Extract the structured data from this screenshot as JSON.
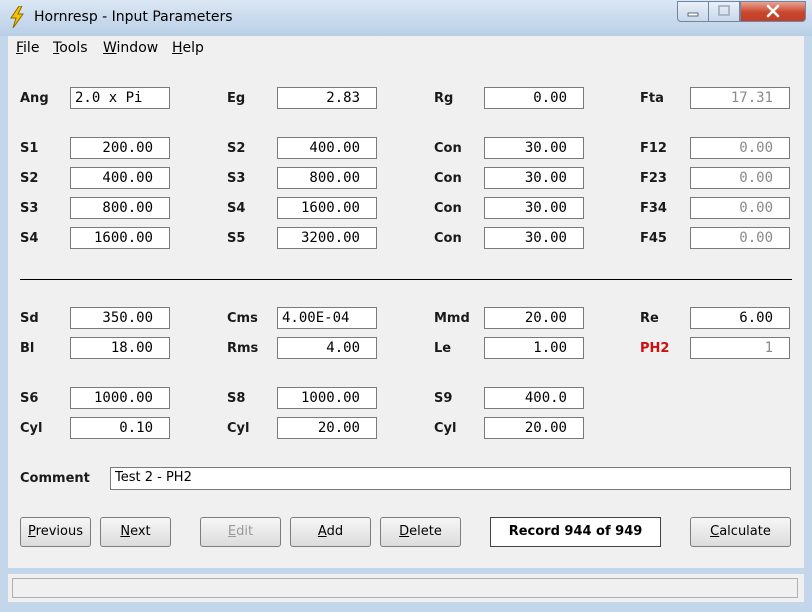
{
  "window": {
    "title": "Hornresp - Input Parameters"
  },
  "menu": [
    {
      "key": "F",
      "rest": "ile"
    },
    {
      "key": "T",
      "rest": "ools"
    },
    {
      "key": "W",
      "rest": "indow"
    },
    {
      "key": "H",
      "rest": "elp"
    }
  ],
  "params": {
    "ang": {
      "label": "Ang",
      "value": "2.0 x Pi"
    },
    "eg": {
      "label": "Eg",
      "value": "2.83"
    },
    "rg": {
      "label": "Rg",
      "value": "0.00"
    },
    "fta": {
      "label": "Fta",
      "value": "17.31"
    },
    "horn_rows": [
      {
        "sa": "S1",
        "sa_val": "200.00",
        "sb": "S2",
        "sb_val": "400.00",
        "con": "Con",
        "con_val": "30.00",
        "f": "F12",
        "f_val": "0.00"
      },
      {
        "sa": "S2",
        "sa_val": "400.00",
        "sb": "S3",
        "sb_val": "800.00",
        "con": "Con",
        "con_val": "30.00",
        "f": "F23",
        "f_val": "0.00"
      },
      {
        "sa": "S3",
        "sa_val": "800.00",
        "sb": "S4",
        "sb_val": "1600.00",
        "con": "Con",
        "con_val": "30.00",
        "f": "F34",
        "f_val": "0.00"
      },
      {
        "sa": "S4",
        "sa_val": "1600.00",
        "sb": "S5",
        "sb_val": "3200.00",
        "con": "Con",
        "con_val": "30.00",
        "f": "F45",
        "f_val": "0.00"
      }
    ],
    "sd": {
      "label": "Sd",
      "value": "350.00"
    },
    "cms": {
      "label": "Cms",
      "value": "4.00E-04"
    },
    "mmd": {
      "label": "Mmd",
      "value": "20.00"
    },
    "re": {
      "label": "Re",
      "value": "6.00"
    },
    "bl": {
      "label": "Bl",
      "value": "18.00"
    },
    "rms": {
      "label": "Rms",
      "value": "4.00"
    },
    "le": {
      "label": "Le",
      "value": "1.00"
    },
    "ph2": {
      "label": "PH2",
      "value": "1"
    },
    "s6": {
      "label": "S6",
      "value": "1000.00"
    },
    "s8": {
      "label": "S8",
      "value": "1000.00"
    },
    "s9": {
      "label": "S9",
      "value": "400.0"
    },
    "cyl1": {
      "label": "Cyl",
      "value": "0.10"
    },
    "cyl2": {
      "label": "Cyl",
      "value": "20.00"
    },
    "cyl3": {
      "label": "Cyl",
      "value": "20.00"
    }
  },
  "comment": {
    "label": "Comment",
    "value": "Test 2 - PH2"
  },
  "buttons": {
    "previous": {
      "key": "P",
      "rest": "revious"
    },
    "next": {
      "key": "N",
      "rest": "ext"
    },
    "edit": {
      "key": "E",
      "rest": "dit"
    },
    "add": {
      "key": "A",
      "rest": "dd"
    },
    "delete": {
      "key": "D",
      "rest": "elete"
    },
    "calculate": {
      "key": "C",
      "rest": "alculate"
    }
  },
  "record": "Record 944 of 949",
  "colors": {
    "label_red": "#cc1010",
    "readonly_text": "#8a8a8a"
  },
  "icons": {
    "app": "lightning-bolt-icon",
    "minimize": "minimize-icon",
    "maximize": "maximize-icon",
    "close": "close-icon"
  }
}
